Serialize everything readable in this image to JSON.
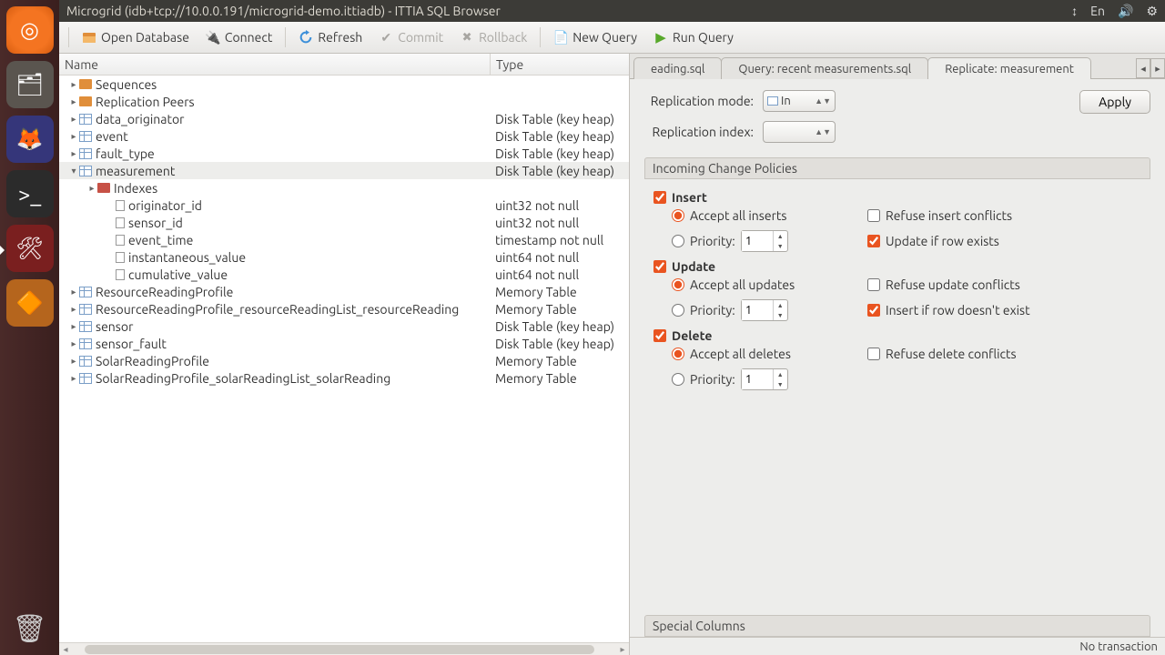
{
  "titlebar": {
    "text": "Microgrid (idb+tcp://10.0.0.191/microgrid-demo.ittiadb) - ITTIA SQL Browser",
    "sys": {
      "net": "↕",
      "lang": "En",
      "vol": "🔊",
      "power": "⚙"
    }
  },
  "toolbar": {
    "open": "Open Database",
    "connect": "Connect",
    "refresh": "Refresh",
    "commit": "Commit",
    "rollback": "Rollback",
    "newquery": "New Query",
    "runquery": "Run Query"
  },
  "schema": {
    "hdr_name": "Name",
    "hdr_type": "Type",
    "rows": [
      {
        "ind": 1,
        "tw": "▸",
        "icon": "grp",
        "name": "Sequences",
        "type": ""
      },
      {
        "ind": 1,
        "tw": "▸",
        "icon": "grp",
        "name": "Replication Peers",
        "type": ""
      },
      {
        "ind": 1,
        "tw": "▸",
        "icon": "tbl",
        "name": "data_originator",
        "type": "Disk Table (key heap)"
      },
      {
        "ind": 1,
        "tw": "▸",
        "icon": "tbl",
        "name": "event",
        "type": "Disk Table (key heap)"
      },
      {
        "ind": 1,
        "tw": "▸",
        "icon": "tbl",
        "name": "fault_type",
        "type": "Disk Table (key heap)"
      },
      {
        "ind": 1,
        "tw": "▾",
        "icon": "tbl",
        "name": "measurement",
        "type": "Disk Table (key heap)",
        "sel": true
      },
      {
        "ind": 2,
        "tw": "▸",
        "icon": "idx",
        "name": "Indexes",
        "type": ""
      },
      {
        "ind": 3,
        "tw": "",
        "icon": "col",
        "name": "originator_id",
        "type": "uint32 not null"
      },
      {
        "ind": 3,
        "tw": "",
        "icon": "col",
        "name": "sensor_id",
        "type": "uint32 not null"
      },
      {
        "ind": 3,
        "tw": "",
        "icon": "col",
        "name": "event_time",
        "type": "timestamp not null"
      },
      {
        "ind": 3,
        "tw": "",
        "icon": "col",
        "name": "instantaneous_value",
        "type": "uint64 not null"
      },
      {
        "ind": 3,
        "tw": "",
        "icon": "col",
        "name": "cumulative_value",
        "type": "uint64 not null"
      },
      {
        "ind": 1,
        "tw": "▸",
        "icon": "tbl",
        "name": "ResourceReadingProfile",
        "type": "Memory Table"
      },
      {
        "ind": 1,
        "tw": "▸",
        "icon": "tbl",
        "name": "ResourceReadingProfile_resourceReadingList_resourceReading",
        "type": "Memory Table"
      },
      {
        "ind": 1,
        "tw": "▸",
        "icon": "tbl",
        "name": "sensor",
        "type": "Disk Table (key heap)"
      },
      {
        "ind": 1,
        "tw": "▸",
        "icon": "tbl",
        "name": "sensor_fault",
        "type": "Disk Table (key heap)"
      },
      {
        "ind": 1,
        "tw": "▸",
        "icon": "tbl",
        "name": "SolarReadingProfile",
        "type": "Memory Table"
      },
      {
        "ind": 1,
        "tw": "▸",
        "icon": "tbl",
        "name": "SolarReadingProfile_solarReadingList_solarReading",
        "type": "Memory Table"
      }
    ]
  },
  "tabs": {
    "t1": "eading.sql",
    "t2": "Query: recent measurements.sql",
    "t3": "Replicate: measurement"
  },
  "form": {
    "mode_label": "Replication mode:",
    "mode_value": "In",
    "index_label": "Replication index:",
    "index_value": "",
    "apply": "Apply"
  },
  "policies": {
    "title": "Incoming Change Policies",
    "insert": {
      "title": "Insert",
      "accept": "Accept all inserts",
      "priority": "Priority:",
      "priority_v": "1",
      "refuse": "Refuse insert conflicts",
      "update_if": "Update if row exists"
    },
    "update": {
      "title": "Update",
      "accept": "Accept all updates",
      "priority": "Priority:",
      "priority_v": "1",
      "refuse": "Refuse update conflicts",
      "insert_if": "Insert if row doesn't exist"
    },
    "delete": {
      "title": "Delete",
      "accept": "Accept all deletes",
      "priority": "Priority:",
      "priority_v": "1",
      "refuse": "Refuse delete conflicts"
    },
    "special": "Special Columns"
  },
  "statusbar": {
    "text": "No transaction"
  }
}
